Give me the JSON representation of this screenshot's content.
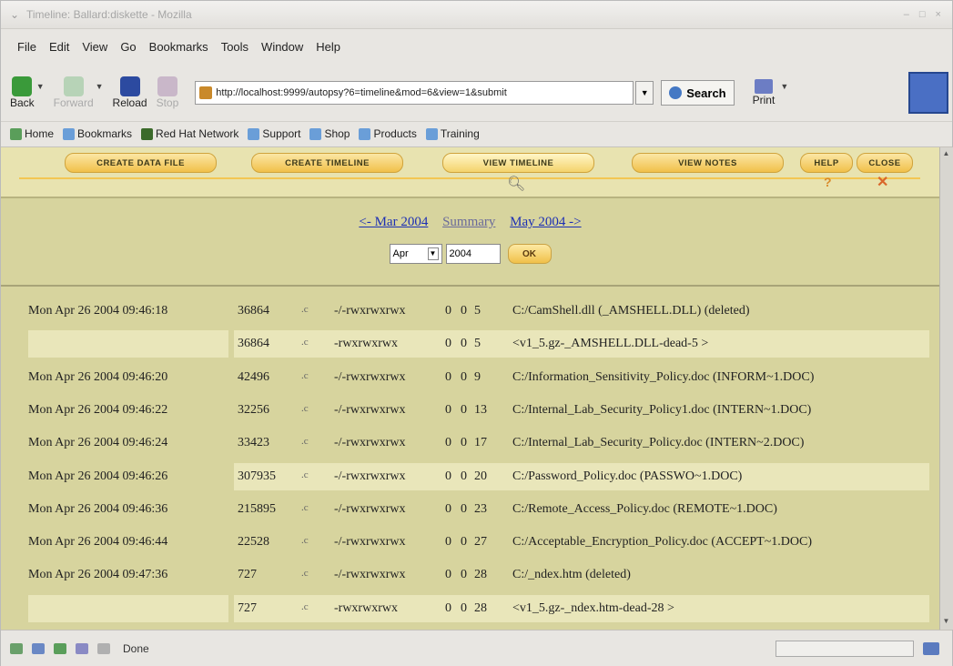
{
  "window": {
    "title": "Timeline: Ballard:diskette - Mozilla",
    "controls": "– □ ×"
  },
  "menu": [
    "File",
    "Edit",
    "View",
    "Go",
    "Bookmarks",
    "Tools",
    "Window",
    "Help"
  ],
  "nav": {
    "back": "Back",
    "forward": "Forward",
    "reload": "Reload",
    "stop": "Stop",
    "url": "http://localhost:9999/autopsy?6=timeline&mod=6&view=1&submit",
    "search": "Search",
    "print": "Print"
  },
  "bookmarks": [
    "Home",
    "Bookmarks",
    "Red Hat Network",
    "Support",
    "Shop",
    "Products",
    "Training"
  ],
  "autopsy": {
    "tabs": {
      "create_data_file": "CREATE DATA FILE",
      "create_timeline": "CREATE TIMELINE",
      "view_timeline": "VIEW TIMELINE",
      "view_notes": "VIEW NOTES",
      "help": "HELP",
      "close": "CLOSE"
    },
    "nav": {
      "prev": "<- Mar 2004",
      "summary": "Summary",
      "next": "May 2004 ->",
      "month": "Apr",
      "year": "2004",
      "ok": "OK"
    },
    "rows": [
      {
        "date": "Mon Apr 26 2004 09:46:18",
        "size": "36864",
        "act": ".c",
        "perm": "-/-rwxrwxrwx",
        "uid": "0",
        "gid": "0",
        "inode": "5",
        "name": "C:/CamShell.dll (_AMSHELL.DLL) (deleted)"
      },
      {
        "date": "",
        "size": "36864",
        "act": ".c",
        "perm": "-rwxrwxrwx",
        "uid": "0",
        "gid": "0",
        "inode": "5",
        "name": "<v1_5.gz-_AMSHELL.DLL-dead-5 >"
      },
      {
        "date": "Mon Apr 26 2004 09:46:20",
        "size": "42496",
        "act": ".c",
        "perm": "-/-rwxrwxrwx",
        "uid": "0",
        "gid": "0",
        "inode": "9",
        "name": "C:/Information_Sensitivity_Policy.doc (INFORM~1.DOC)"
      },
      {
        "date": "Mon Apr 26 2004 09:46:22",
        "size": "32256",
        "act": ".c",
        "perm": "-/-rwxrwxrwx",
        "uid": "0",
        "gid": "0",
        "inode": "13",
        "name": "C:/Internal_Lab_Security_Policy1.doc (INTERN~1.DOC)"
      },
      {
        "date": "Mon Apr 26 2004 09:46:24",
        "size": "33423",
        "act": ".c",
        "perm": "-/-rwxrwxrwx",
        "uid": "0",
        "gid": "0",
        "inode": "17",
        "name": "C:/Internal_Lab_Security_Policy.doc (INTERN~2.DOC)"
      },
      {
        "date": "Mon Apr 26 2004 09:46:26",
        "size": "307935",
        "act": ".c",
        "perm": "-/-rwxrwxrwx",
        "uid": "0",
        "gid": "0",
        "inode": "20",
        "name": "C:/Password_Policy.doc (PASSWO~1.DOC)"
      },
      {
        "date": "Mon Apr 26 2004 09:46:36",
        "size": "215895",
        "act": ".c",
        "perm": "-/-rwxrwxrwx",
        "uid": "0",
        "gid": "0",
        "inode": "23",
        "name": "C:/Remote_Access_Policy.doc (REMOTE~1.DOC)"
      },
      {
        "date": "Mon Apr 26 2004 09:46:44",
        "size": "22528",
        "act": ".c",
        "perm": "-/-rwxrwxrwx",
        "uid": "0",
        "gid": "0",
        "inode": "27",
        "name": "C:/Acceptable_Encryption_Policy.doc (ACCEPT~1.DOC)"
      },
      {
        "date": "Mon Apr 26 2004 09:47:36",
        "size": "727",
        "act": ".c",
        "perm": "-/-rwxrwxrwx",
        "uid": "0",
        "gid": "0",
        "inode": "28",
        "name": "C:/_ndex.htm (deleted)"
      },
      {
        "date": "",
        "size": "727",
        "act": ".c",
        "perm": "-rwxrwxrwx",
        "uid": "0",
        "gid": "0",
        "inode": "28",
        "name": "<v1_5.gz-_ndex.htm-dead-28 >"
      }
    ]
  },
  "status": {
    "text": "Done"
  },
  "colors": {
    "tool_bg": "#e8e3b0",
    "nav_bg": "#d7d49e",
    "link": "#1c2fb4",
    "button": "#f1c04a"
  }
}
